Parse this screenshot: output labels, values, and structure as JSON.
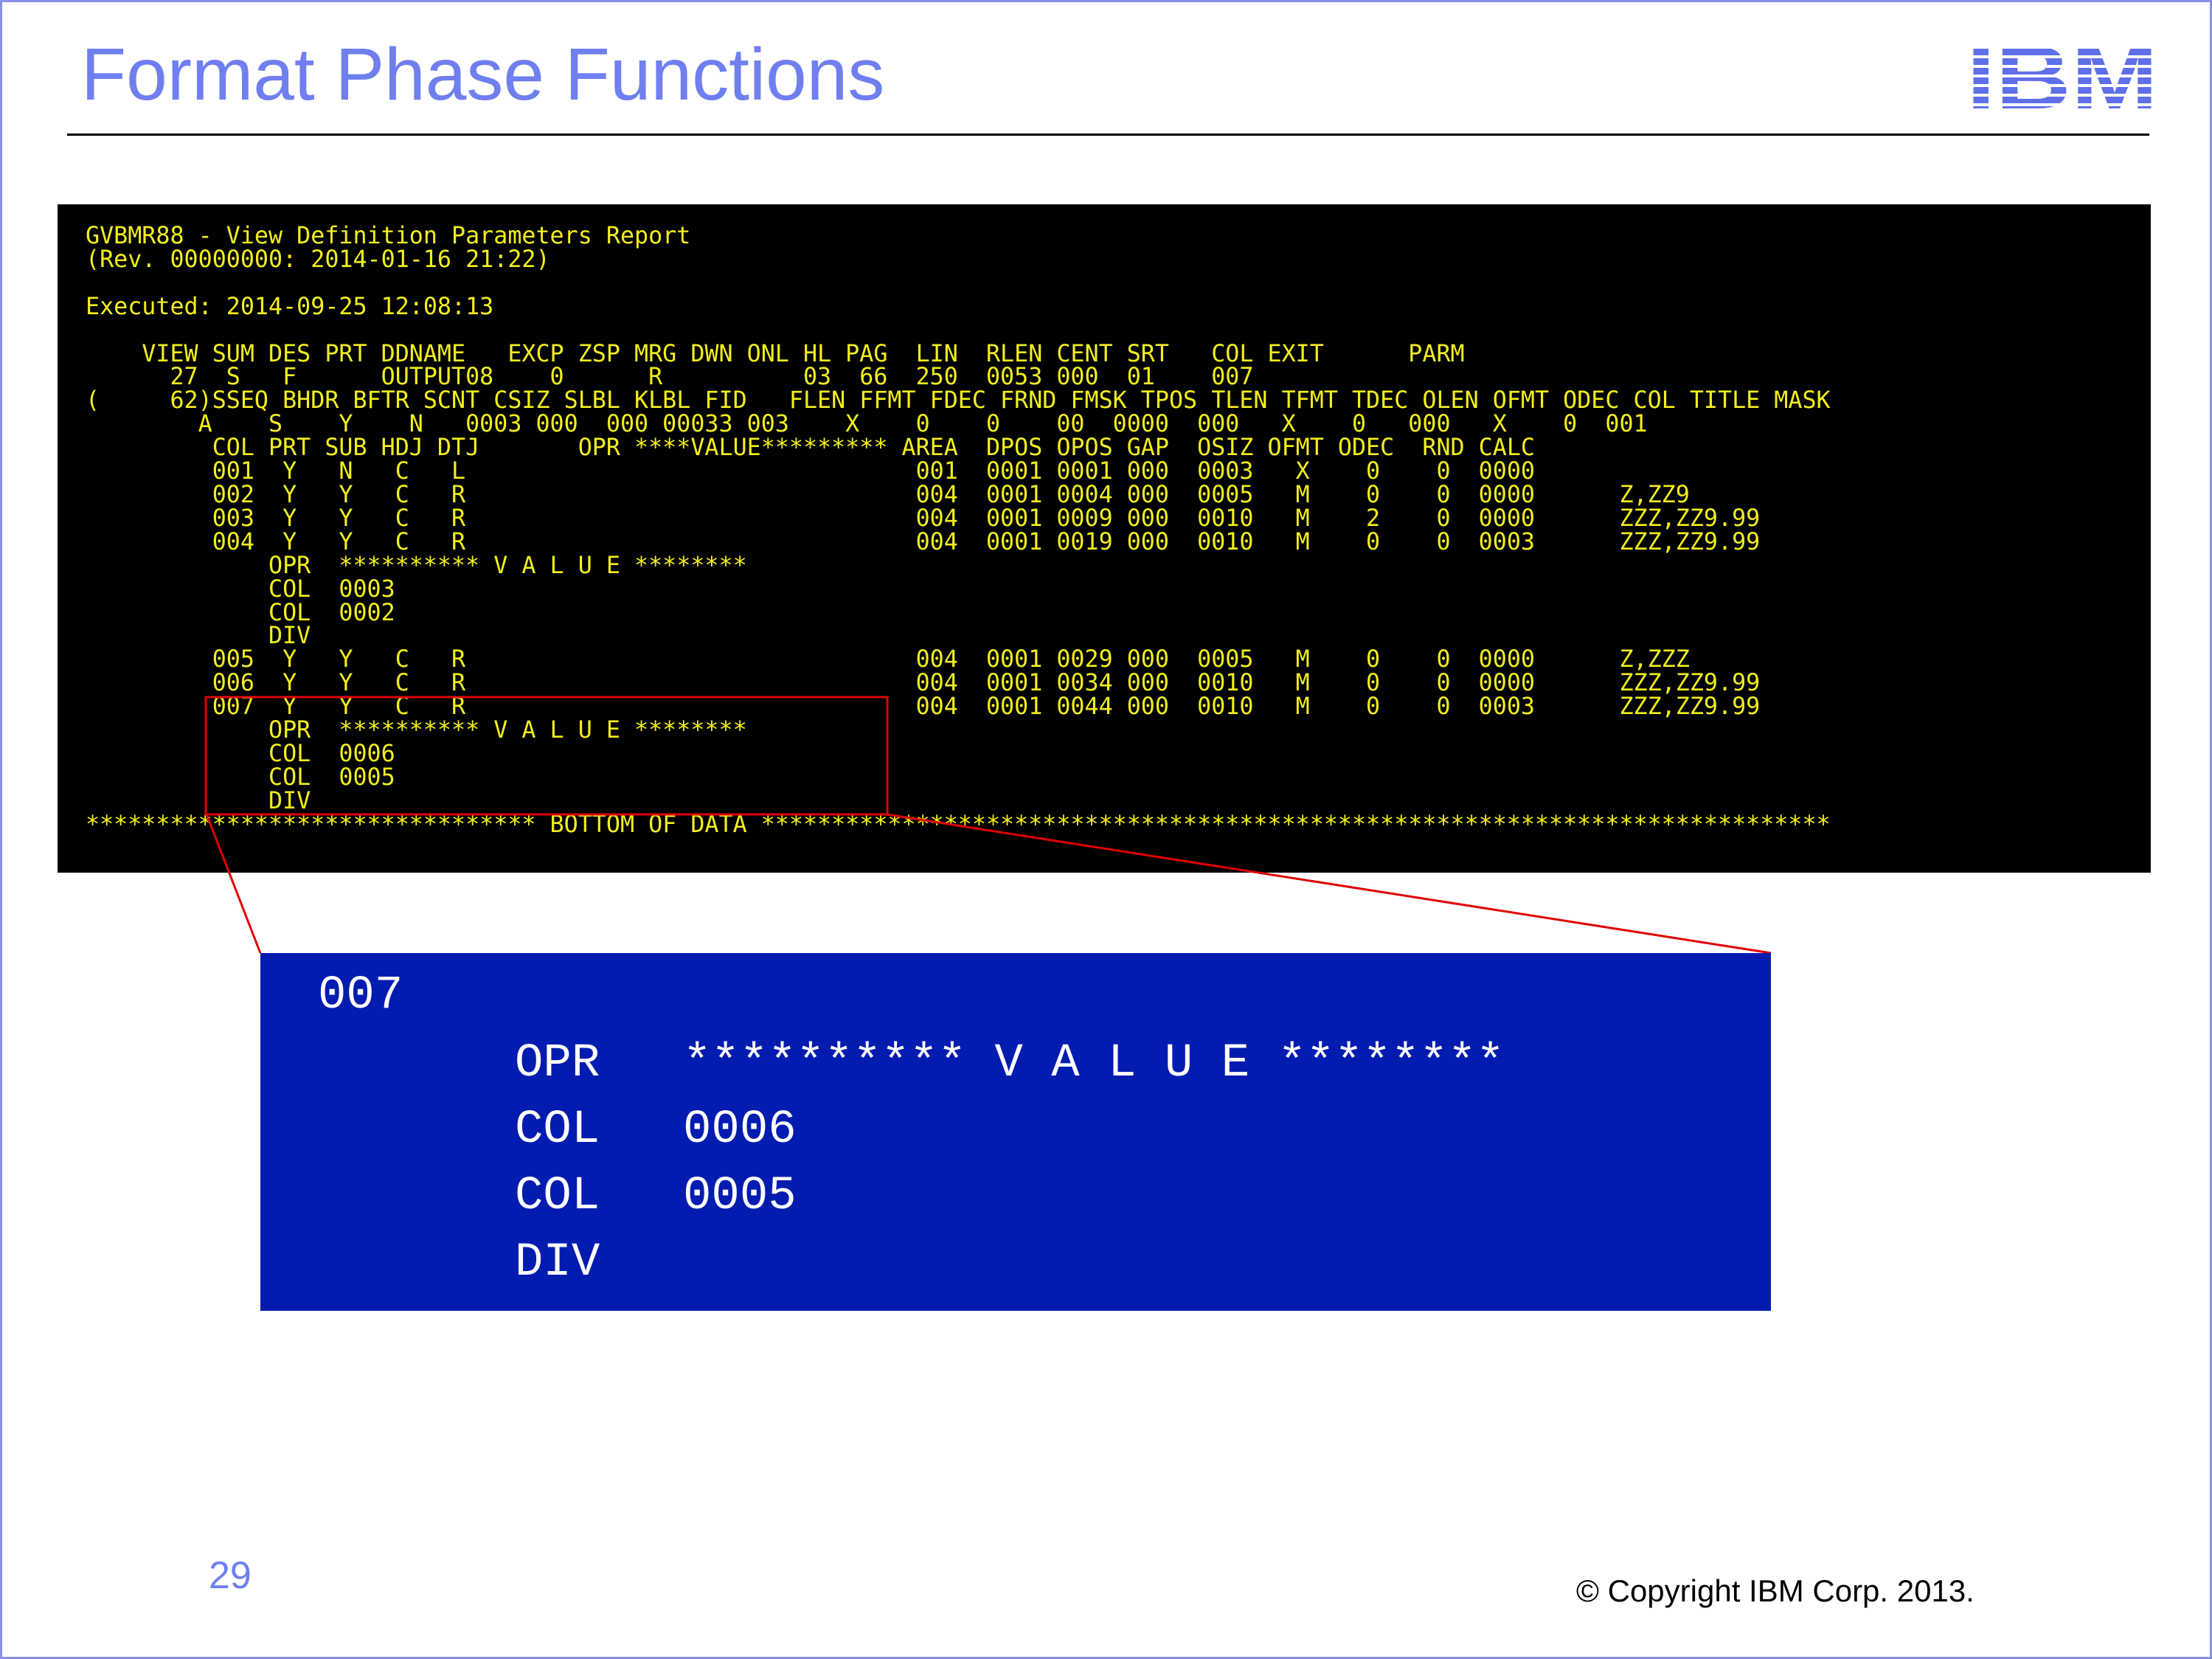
{
  "slide": {
    "title": "Format Phase Functions",
    "logo_text": "IBM",
    "page_number": "29",
    "copyright": "© Copyright IBM Corp. 2013."
  },
  "terminal": {
    "lines": [
      "GVBMR88 - View Definition Parameters Report",
      "(Rev. 00000000: 2014-01-16 21:22)",
      "",
      "Executed: 2014-09-25 12:08:13",
      "",
      "    VIEW SUM DES PRT DDNAME   EXCP ZSP MRG DWN ONL HL PAG  LIN  RLEN CENT SRT   COL EXIT      PARM",
      "      27  S   F      OUTPUT08    0      R          03  66  250  0053 000  01    007",
      "(     62)SSEQ BHDR BFTR SCNT CSIZ SLBL KLBL FID   FLEN FFMT FDEC FRND FMSK TPOS TLEN TFMT TDEC OLEN OFMT ODEC COL TITLE MASK",
      "        A    S    Y    N   0003 000  000 00033 003    X    0    0    00  0000  000   X    0   000   X    0  001",
      "         COL PRT SUB HDJ DTJ       OPR ****VALUE********* AREA  DPOS OPOS GAP  OSIZ OFMT ODEC  RND CALC",
      "         001  Y   N   C   L                                001  0001 0001 000  0003   X    0    0  0000",
      "         002  Y   Y   C   R                                004  0001 0004 000  0005   M    0    0  0000      Z,ZZ9",
      "         003  Y   Y   C   R                                004  0001 0009 000  0010   M    2    0  0000      ZZZ,ZZ9.99",
      "         004  Y   Y   C   R                                004  0001 0019 000  0010   M    0    0  0003      ZZZ,ZZ9.99",
      "             OPR  ********** V A L U E ********",
      "             COL  0003",
      "             COL  0002",
      "             DIV",
      "         005  Y   Y   C   R                                004  0001 0029 000  0005   M    0    0  0000      Z,ZZZ",
      "         006  Y   Y   C   R                                004  0001 0034 000  0010   M    0    0  0000      ZZZ,ZZ9.99",
      "         007  Y   Y   C   R                                004  0001 0044 000  0010   M    0    0  0003      ZZZ,ZZ9.99",
      "             OPR  ********** V A L U E ********",
      "             COL  0006",
      "             COL  0005",
      "             DIV",
      "******************************** BOTTOM OF DATA ****************************************************************************"
    ]
  },
  "zoom": {
    "col_number": "007",
    "opr_label": "OPR",
    "opr_value": "********** V A L U E ********",
    "col1_label": "COL",
    "col1_value": "0006",
    "col2_label": "COL",
    "col2_value": "0005",
    "div_label": "DIV"
  },
  "colors": {
    "title": "#6f7ff0",
    "terminal_background": "#000000",
    "terminal_text": "#f2ef1c",
    "callout_background": "#031cb0",
    "callout_text": "#ffffff",
    "highlight": "#e00000"
  }
}
